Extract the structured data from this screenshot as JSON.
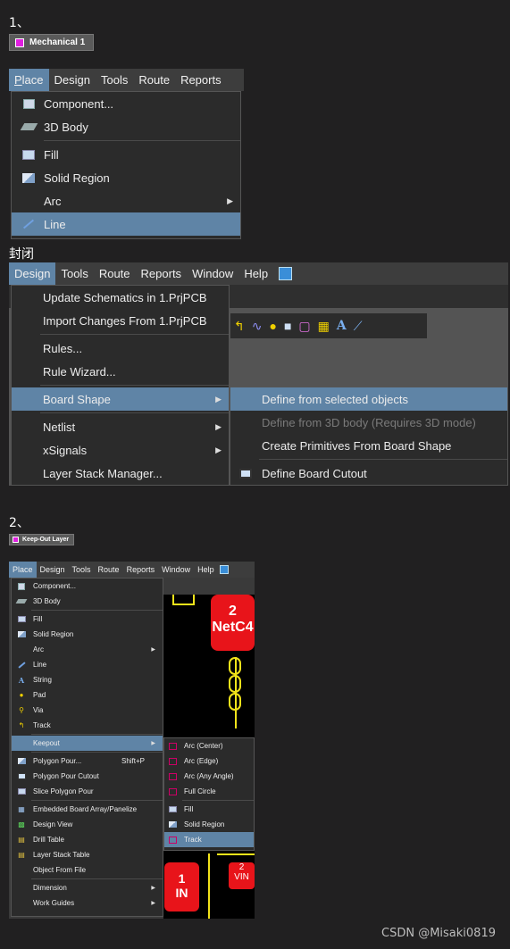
{
  "section1": {
    "caption": "1、",
    "layer_chip": "Mechanical 1",
    "menubar": [
      "Place",
      "Design",
      "Tools",
      "Route",
      "Reports"
    ],
    "place_menu": [
      {
        "label": "Component...",
        "icon": "component-icon"
      },
      {
        "label": "3D Body",
        "icon": "3d-body-icon"
      },
      {
        "label": "Fill",
        "icon": "fill-icon"
      },
      {
        "label": "Solid Region",
        "icon": "solid-region-icon"
      },
      {
        "label": "Arc",
        "icon": "arc-icon"
      },
      {
        "label": "Line",
        "icon": "line-icon"
      }
    ],
    "close_caption": "封闭"
  },
  "design_section": {
    "menubar": [
      "Design",
      "Tools",
      "Route",
      "Reports",
      "Window",
      "Help"
    ],
    "design_menu": [
      "Update Schematics in 1.PrjPCB",
      "Import Changes From 1.PrjPCB",
      "Rules...",
      "Rule Wizard...",
      "Board Shape",
      "Netlist",
      "xSignals",
      "Layer Stack Manager..."
    ],
    "board_shape_submenu": [
      "Define from selected objects",
      "Define from 3D body (Requires 3D mode)",
      "Create Primitives From Board Shape",
      "Define Board Cutout"
    ]
  },
  "section2": {
    "caption": "2、",
    "layer_chip": "Keep-Out Layer",
    "menubar": [
      "Place",
      "Design",
      "Tools",
      "Route",
      "Reports",
      "Window",
      "Help"
    ],
    "place_menu": [
      "Component...",
      "3D Body",
      "Fill",
      "Solid Region",
      "Arc",
      "Line",
      "String",
      "Pad",
      "Via",
      "Track",
      "Keepout",
      "Polygon Pour...",
      "Polygon Pour Cutout",
      "Slice Polygon Pour",
      "Embedded Board Array/Panelize",
      "Design View",
      "Drill Table",
      "Layer Stack Table",
      "Object From File",
      "Dimension",
      "Work Guides"
    ],
    "polygon_shortcut": "Shift+P",
    "keepout_submenu": [
      "Arc (Center)",
      "Arc (Edge)",
      "Arc (Any Angle)",
      "Full Circle",
      "Fill",
      "Solid Region",
      "Track"
    ],
    "pcb_labels": {
      "pad_num_top": "2",
      "pad_net_top": "NetC4",
      "pad1_num": "1",
      "pad1_net": "IN",
      "pad2_num": "2",
      "pad2_net": "VIN"
    }
  },
  "watermark": "CSDN @Misaki0819",
  "colors": {
    "accent": "#5f84a6",
    "layer_swatch": "#e01fe0",
    "pad_red": "#e8141a",
    "trace_yellow": "#f2e31a"
  }
}
